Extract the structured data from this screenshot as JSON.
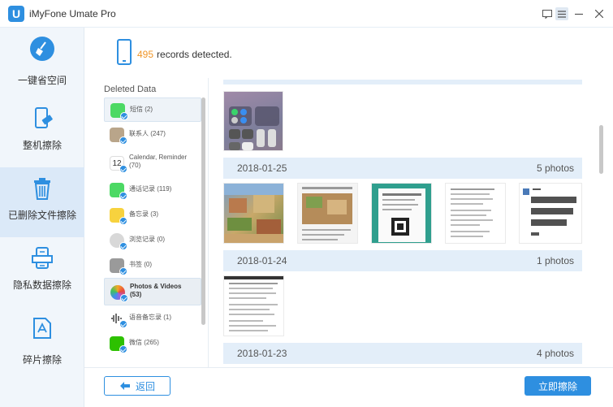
{
  "app": {
    "title": "iMyFone Umate Pro",
    "logo_letter": "U",
    "accent": "#2e8fe0"
  },
  "sidebar": {
    "items": [
      {
        "label": "一键省空间",
        "icon": "broom-icon"
      },
      {
        "label": "整机擦除",
        "icon": "phone-erase-icon"
      },
      {
        "label": "已删除文件擦除",
        "icon": "trash-icon"
      },
      {
        "label": "隐私数据擦除",
        "icon": "private-data-icon"
      },
      {
        "label": "碎片擦除",
        "icon": "fragment-icon"
      }
    ],
    "active_index": 2
  },
  "header": {
    "records_count": "495",
    "records_text": "records detected."
  },
  "categories": {
    "title": "Deleted Data",
    "items": [
      {
        "label": "短信 (2)",
        "icon": "messages-icon",
        "color": "#4cd964"
      },
      {
        "label": "联系人 (247)",
        "icon": "contacts-icon",
        "color": "#b9a58a"
      },
      {
        "label": "Calendar, Reminder (70)",
        "icon": "calendar-icon",
        "color": "#ffffff"
      },
      {
        "label": "通话记录 (119)",
        "icon": "phone-icon",
        "color": "#4cd964"
      },
      {
        "label": "备忘录 (3)",
        "icon": "notes-icon",
        "color": "#f7d23e"
      },
      {
        "label": "浏览记录 (0)",
        "icon": "safari-icon",
        "color": "#d8d8d8"
      },
      {
        "label": "书签 (0)",
        "icon": "bookmark-icon",
        "color": "#9a9a9a"
      },
      {
        "label": "Photos & Videos (53)",
        "icon": "photos-icon",
        "color": "#f6a623"
      },
      {
        "label": "语音备忘录 (1)",
        "icon": "voice-memo-icon",
        "color": "#333333"
      },
      {
        "label": "微信 (265)",
        "icon": "wechat-icon",
        "color": "#2dc100"
      }
    ]
  },
  "photos": {
    "groups": [
      {
        "date": "2018-01-25",
        "count": "5 photos"
      },
      {
        "date": "2018-01-24",
        "count": "1 photos"
      },
      {
        "date": "2018-01-23",
        "count": "4 photos"
      }
    ]
  },
  "footer": {
    "back_label": "返回",
    "erase_label": "立即擦除"
  }
}
